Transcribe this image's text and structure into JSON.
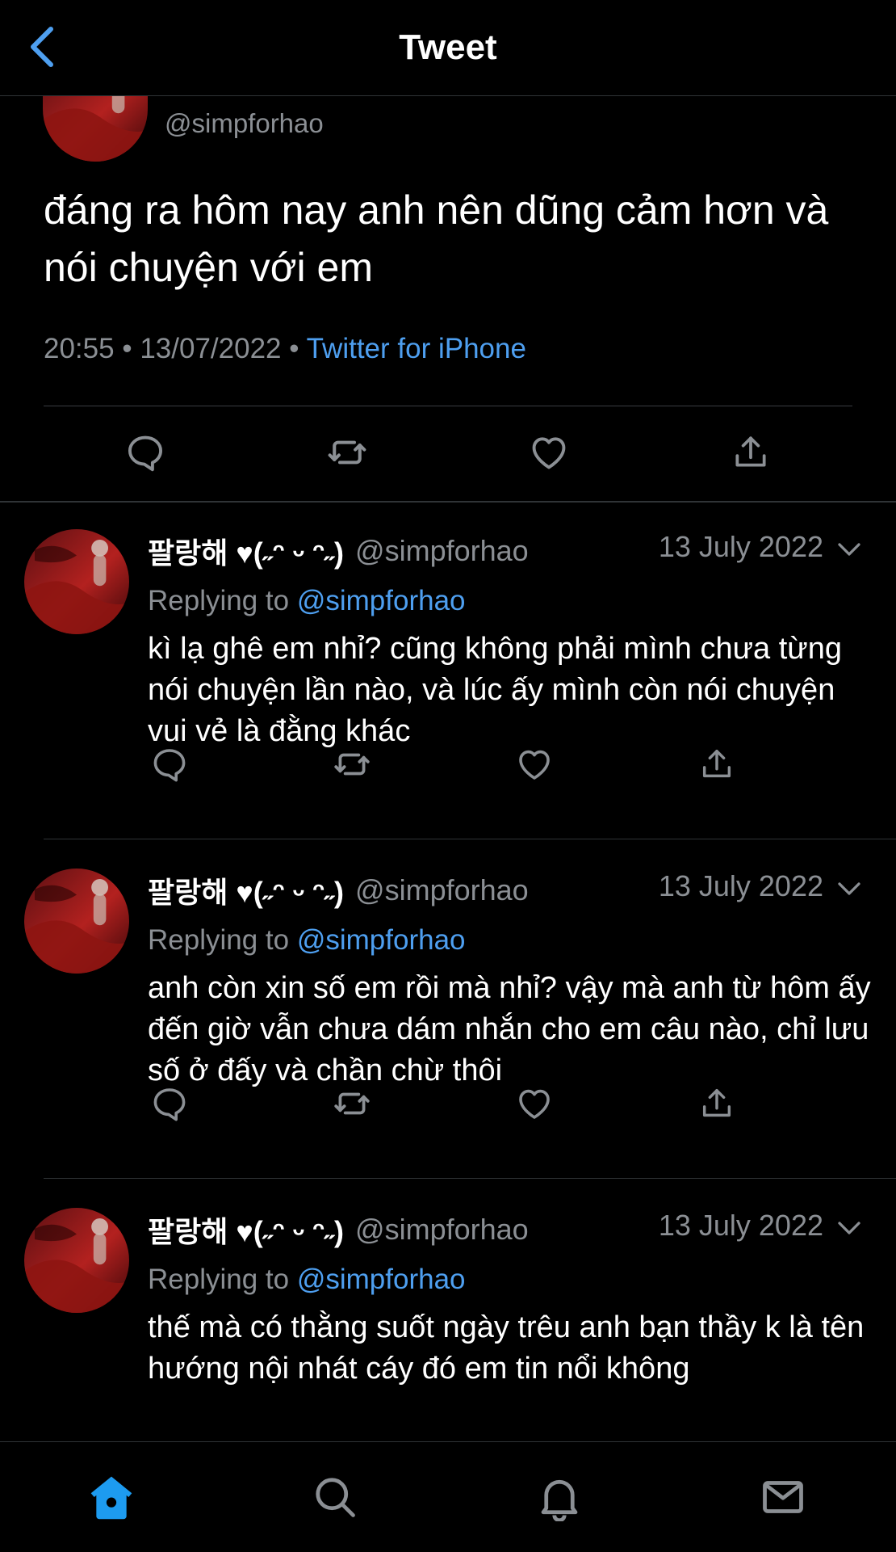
{
  "header": {
    "title": "Tweet",
    "back_icon": "chevron-left-icon"
  },
  "colors": {
    "background": "#000000",
    "accent": "#4e9ff0",
    "muted": "#8b8f94",
    "divider": "#2f3336"
  },
  "main_tweet": {
    "handle": "@simpforhao",
    "text": "đáng ra hôm nay anh nên dũng cảm hơn và nói chuyện với em",
    "time": "20:55",
    "date": "13/07/2022",
    "dot": "•",
    "source": "Twitter for iPhone",
    "actions": [
      "reply-icon",
      "retweet-icon",
      "like-icon",
      "share-icon"
    ]
  },
  "replies": [
    {
      "display_name": "팔랑해 ♥(˶ᵔ ᵕ ᵔ˶)",
      "handle": "@simpforhao",
      "date": "13 July 2022",
      "replying_label": "Replying to",
      "replying_to": "@simpforhao",
      "text": "kì lạ ghê em nhỉ? cũng không phải mình chưa từng nói chuyện lần nào, và lúc ấy mình còn nói chuyện vui vẻ là đằng khác"
    },
    {
      "display_name": "팔랑해 ♥(˶ᵔ ᵕ ᵔ˶)",
      "handle": "@simpforhao",
      "date": "13 July 2022",
      "replying_label": "Replying to",
      "replying_to": "@simpforhao",
      "text": "anh còn xin số em rồi mà nhỉ? vậy mà anh từ hôm ấy đến giờ vẫn chưa dám nhắn cho em câu nào, chỉ lưu số ở đấy và chần chừ thôi"
    },
    {
      "display_name": "팔랑해 ♥(˶ᵔ ᵕ ᵔ˶)",
      "handle": "@simpforhao",
      "date": "13 July 2022",
      "replying_label": "Replying to",
      "replying_to": "@simpforhao",
      "text": "thế mà có thằng suốt ngày trêu anh bạn thầy k là tên hướng nội nhát cáy đó em tin nổi không"
    }
  ],
  "bottom_nav": [
    "home-icon",
    "search-icon",
    "notifications-icon",
    "messages-icon"
  ]
}
